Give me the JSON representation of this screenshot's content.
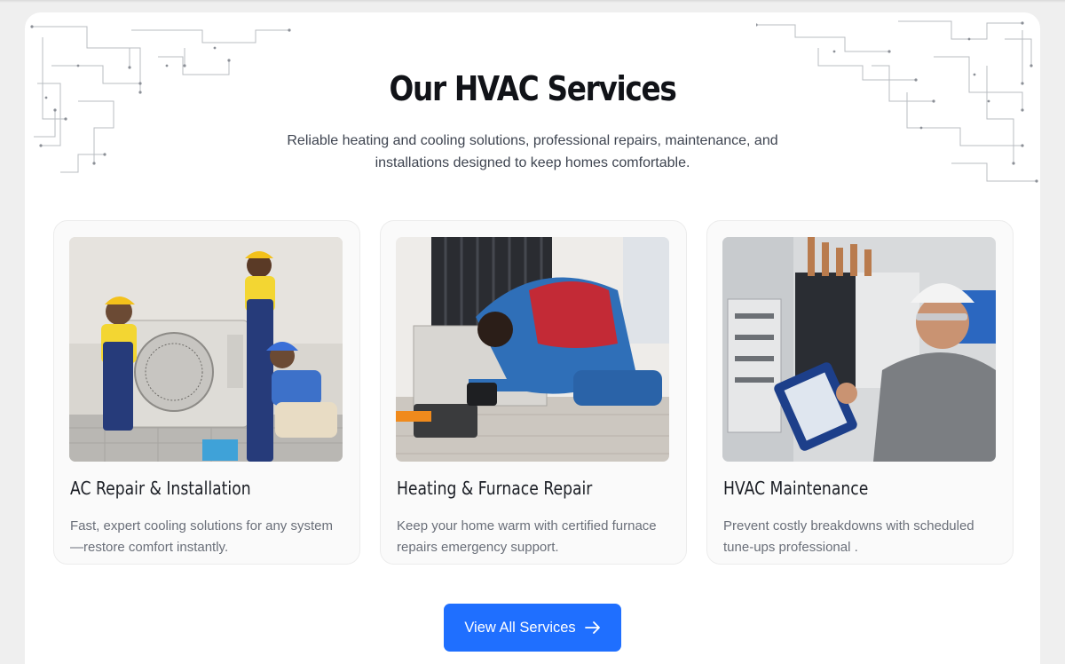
{
  "section": {
    "title": "Our HVAC Services",
    "subtitle": "Reliable heating and cooling solutions, professional repairs, maintenance, and installations designed to keep homes comfortable."
  },
  "services": [
    {
      "title": "AC Repair & Installation",
      "description": "Fast, expert cooling solutions for any system—restore comfort instantly.",
      "photo_icon": "ac-installation-photo"
    },
    {
      "title": "Heating & Furnace Repair",
      "description": "Keep your home warm with certified furnace repairs emergency support.",
      "photo_icon": "furnace-repair-photo"
    },
    {
      "title": "HVAC Maintenance",
      "description": "Prevent costly breakdowns with scheduled tune-ups  professional .",
      "photo_icon": "maintenance-photo"
    }
  ],
  "cta": {
    "label": "View All Services",
    "icon": "arrow-right-icon"
  },
  "colors": {
    "accent": "#1f6fff",
    "heading": "#111318",
    "body_text": "#6a6f79",
    "card_background": "#fafafa"
  }
}
